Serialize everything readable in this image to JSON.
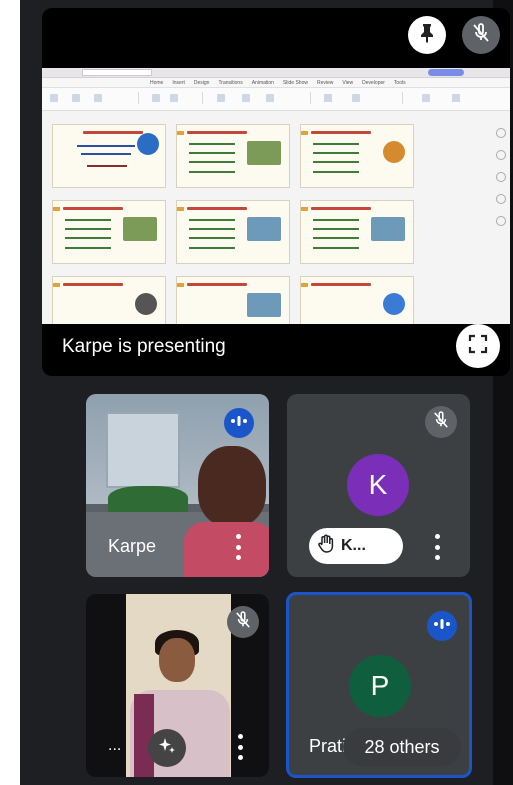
{
  "presentation": {
    "label": "Karpe is presenting",
    "icons": {
      "pin": "pin-icon",
      "mute": "mic-off-icon",
      "fullscreen": "fullscreen-icon"
    },
    "app_menu": [
      "Home",
      "Insert",
      "Design",
      "Transitions",
      "Animation",
      "Slide Show",
      "Review",
      "View",
      "Developer",
      "Tools"
    ]
  },
  "participants": [
    {
      "name": "Karpe",
      "status": "speaking",
      "avatar_letter": "",
      "avatar_color": ""
    },
    {
      "name": "",
      "status": "muted",
      "avatar_letter": "K",
      "avatar_color": "#7b2fb8",
      "hand_raised_label": "K..."
    },
    {
      "name": "...",
      "status": "muted",
      "avatar_letter": "",
      "avatar_color": ""
    },
    {
      "name": "Prati",
      "status": "speaking",
      "avatar_letter": "P",
      "avatar_color": "#0f5f3e",
      "others_label": "28 others"
    }
  ],
  "colors": {
    "speaking_blue": "#1a56c9",
    "tile_gray": "#3c4043",
    "background": "#1e1f22"
  }
}
